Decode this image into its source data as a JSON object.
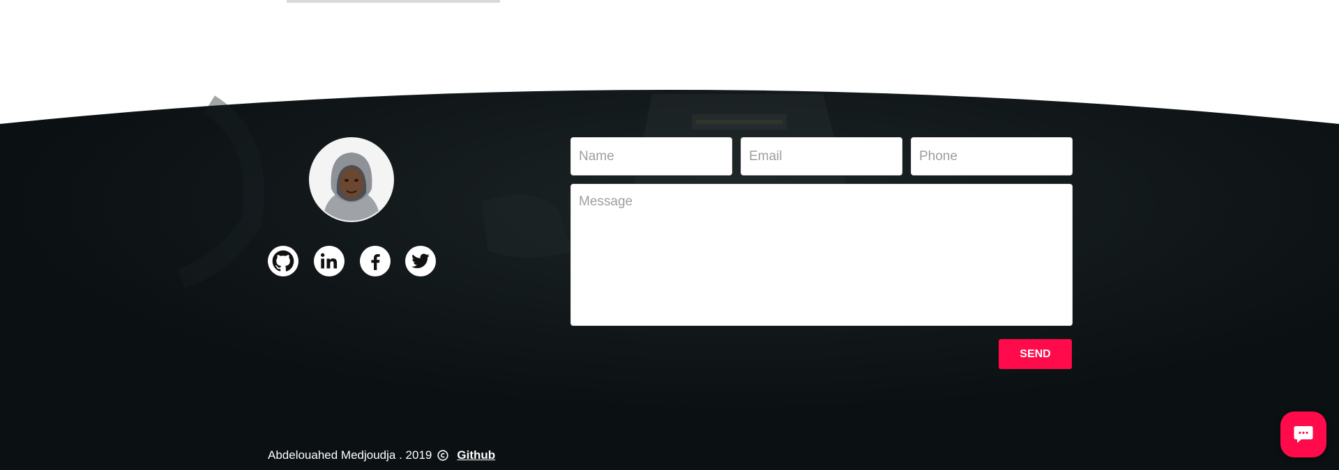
{
  "colors": {
    "accent": "#ff0a4a",
    "footer_background": "#0b1012",
    "page_background": "#ffffff"
  },
  "profile": {
    "avatar_icon": "person-avatar-icon"
  },
  "social_links": [
    {
      "name": "github",
      "icon": "github-icon"
    },
    {
      "name": "linkedin",
      "icon": "linkedin-icon"
    },
    {
      "name": "facebook",
      "icon": "facebook-icon"
    },
    {
      "name": "twitter",
      "icon": "twitter-icon"
    }
  ],
  "contact_form": {
    "name_placeholder": "Name",
    "email_placeholder": "Email",
    "phone_placeholder": "Phone",
    "message_placeholder": "Message",
    "name_value": "",
    "email_value": "",
    "phone_value": "",
    "message_value": "",
    "send_label": "SEND"
  },
  "footer": {
    "credit_text": "Abdelouahed Medjoudja . 2019",
    "copyright_icon": "copyright-icon",
    "github_link_label": "Github"
  },
  "chat_widget": {
    "icon": "chat-bubble-icon"
  }
}
